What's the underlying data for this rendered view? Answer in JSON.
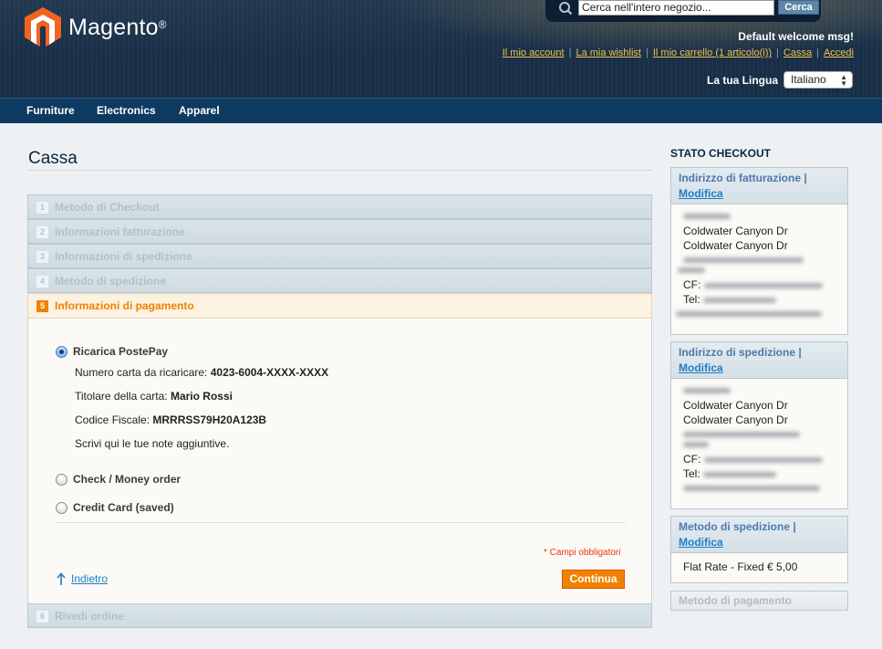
{
  "header": {
    "logo_text": "Magento",
    "logo_reg": "®",
    "search_placeholder": "Cerca nell'intero negozio...",
    "search_button": "Cerca",
    "welcome": "Default welcome msg!",
    "links": [
      "Il mio account",
      "La mia wishlist",
      "Il mio carrello (1 articolo(i))",
      "Cassa",
      "Accedi"
    ],
    "language_label": "La tua Lingua",
    "language_value": "Italiano"
  },
  "nav": [
    "Furniture",
    "Electronics",
    "Apparel"
  ],
  "page_title": "Cassa",
  "steps": [
    {
      "num": "1",
      "label": "Metodo di Checkout"
    },
    {
      "num": "2",
      "label": "Informazioni fatturazione"
    },
    {
      "num": "3",
      "label": "Informazioni di spedizione"
    },
    {
      "num": "4",
      "label": "Metodo di spedizione"
    },
    {
      "num": "5",
      "label": "Informazioni di pagamento"
    },
    {
      "num": "6",
      "label": "Rivedi ordine"
    }
  ],
  "payment": {
    "option1": "Ricarica PostePay",
    "card_label": "Numero carta da ricaricare:",
    "card_value": "4023-6004-XXXX-XXXX",
    "holder_label": "Titolare della carta:",
    "holder_value": "Mario Rossi",
    "cf_label": "Codice Fiscale:",
    "cf_value": "MRRRSS79H20A123B",
    "notes": "Scrivi qui le tue note aggiuntive.",
    "option2": "Check / Money order",
    "option3": "Credit Card (saved)",
    "required": "* Campi obbligatori",
    "back": "Indietro",
    "continue": "Continua"
  },
  "sidebar": {
    "title": "STATO CHECKOUT",
    "billing_title": "Indirizzo di fatturazione",
    "shipping_title": "Indirizzo di spedizione",
    "method_title": "Metodo di spedizione",
    "edit": "Modifica",
    "sep": "|",
    "street1": "Coldwater Canyon Dr",
    "street2": "Coldwater Canyon Dr",
    "cf": "CF:",
    "tel": "Tel:",
    "shipping_method": "Flat Rate - Fixed € 5,00",
    "payment_title": "Metodo di pagamento"
  },
  "colors": {
    "accent_orange": "#f18200",
    "link_blue": "#1e7ec8",
    "nav_blue": "#0e3a61"
  }
}
